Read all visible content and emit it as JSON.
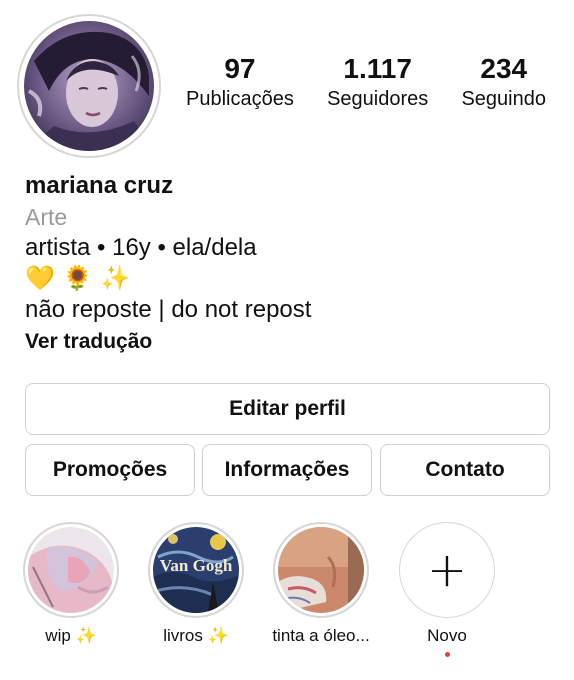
{
  "profile": {
    "name": "mariana cruz",
    "category": "Arte",
    "bio_line1": "artista • 16y • ela/dela",
    "bio_emojis": [
      "💛",
      "🌻",
      "✨"
    ],
    "bio_line3": "não reposte | do not repost",
    "translate_label": "Ver tradução"
  },
  "stats": {
    "posts": {
      "value": "97",
      "label": "Publicações"
    },
    "followers": {
      "value": "1.117",
      "label": "Seguidores"
    },
    "following": {
      "value": "234",
      "label": "Seguindo"
    }
  },
  "buttons": {
    "edit": "Editar perfil",
    "promotions": "Promoções",
    "info": "Informações",
    "contact": "Contato"
  },
  "highlights": [
    {
      "label": "wip ✨"
    },
    {
      "label": "livros ✨",
      "cover_text": "Van Gogh"
    },
    {
      "label": "tinta a óleo..."
    },
    {
      "label": "Novo"
    }
  ],
  "colors": {
    "border": "#d0d0d0",
    "muted_text": "#9a9a9a",
    "notification_dot": "#e0424b"
  }
}
